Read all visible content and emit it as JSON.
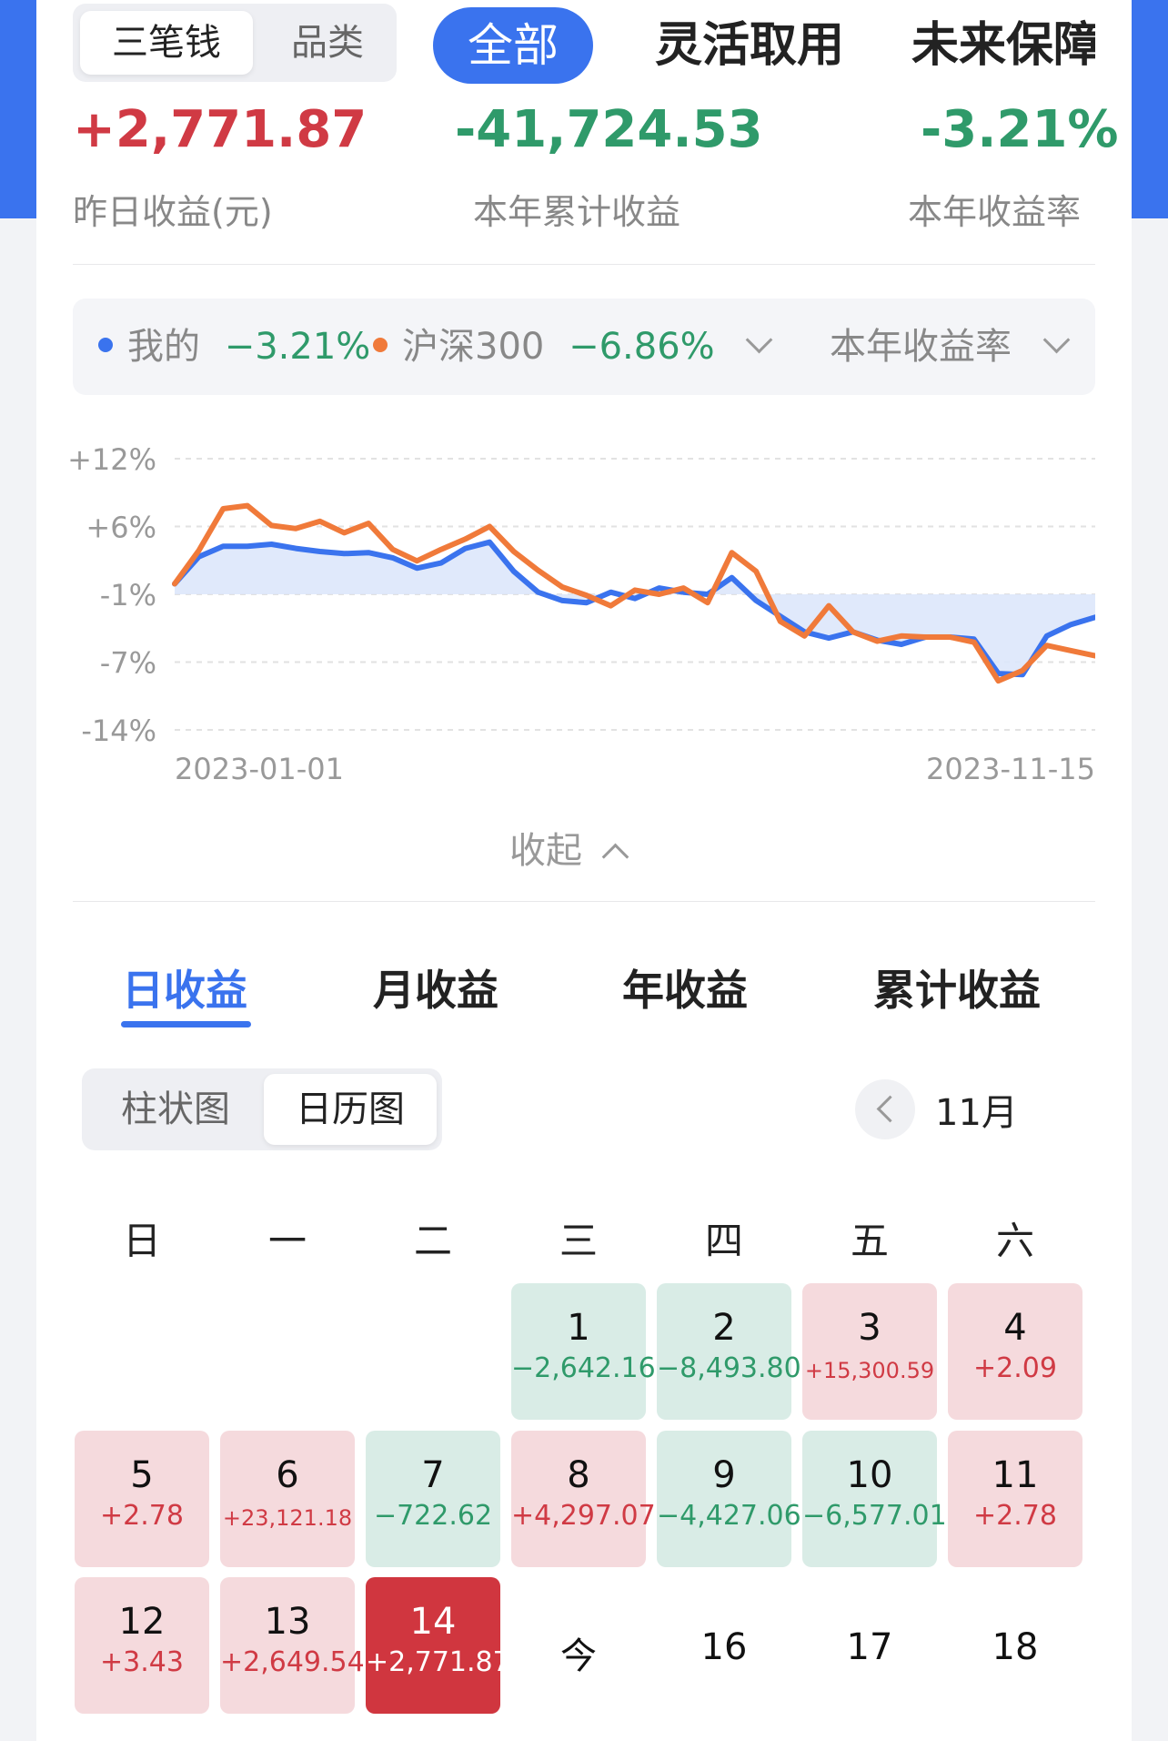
{
  "top": {
    "segments": [
      "三笔钱",
      "品类"
    ],
    "tabs": [
      "全部",
      "灵活取用",
      "未来保障"
    ]
  },
  "summary": [
    {
      "value": "+2,771.87",
      "label": "昨日收益(元)"
    },
    {
      "value": "-41,724.53",
      "label": "本年累计收益"
    },
    {
      "value": "-3.21%",
      "label": "本年收益率"
    }
  ],
  "legend": {
    "mine_label": "我的",
    "mine_value": "−3.21%",
    "index_label": "沪深300",
    "index_value": "−6.86%",
    "metric": "本年收益率"
  },
  "chart_data": {
    "type": "line",
    "x_range": [
      "2023-01-01",
      "2023-11-15"
    ],
    "xlabels": [
      "2023-01-01",
      "2023-11-15"
    ],
    "yticks": [
      "+12%",
      "+6%",
      "-1%",
      "-7%",
      "-14%"
    ],
    "ylim": [
      -14,
      12
    ],
    "colors": {
      "mine": "#3a73ee",
      "index": "#f07a3a"
    },
    "series": [
      {
        "name": "我的",
        "values": [
          0,
          2.6,
          3.6,
          3.6,
          3.8,
          3.4,
          3.1,
          2.9,
          3.0,
          2.5,
          1.5,
          2.0,
          3.4,
          4.0,
          1.2,
          -0.8,
          -1.6,
          -1.8,
          -0.8,
          -1.4,
          -0.4,
          -0.8,
          -1.0,
          0.6,
          -1.6,
          -3.1,
          -4.6,
          -5.2,
          -4.6,
          -5.4,
          -5.8,
          -5.1,
          -5.1,
          -5.3,
          -8.6,
          -8.7,
          -5.0,
          -3.9,
          -3.2
        ]
      },
      {
        "name": "沪深300",
        "values": [
          0,
          3.2,
          7.2,
          7.5,
          5.6,
          5.3,
          6.0,
          4.9,
          5.8,
          3.3,
          2.2,
          3.3,
          4.3,
          5.5,
          3.1,
          1.3,
          -0.3,
          -1.1,
          -2.1,
          -0.6,
          -1.0,
          -0.4,
          -1.8,
          3.0,
          1.2,
          -3.6,
          -5.0,
          -2.1,
          -4.6,
          -5.5,
          -5.0,
          -5.1,
          -5.1,
          -5.6,
          -9.3,
          -8.3,
          -5.9,
          -6.4,
          -6.9
        ]
      }
    ]
  },
  "collapse_label": "收起",
  "period_tabs": [
    "日收益",
    "月收益",
    "年收益",
    "累计收益"
  ],
  "chart_modes": [
    "柱状图",
    "日历图"
  ],
  "month": "11月",
  "weekdays": [
    "日",
    "一",
    "二",
    "三",
    "四",
    "五",
    "六"
  ],
  "calendar": [
    {
      "day": "1",
      "value": "−2,642.16",
      "sign": "neg",
      "col": 3,
      "row": 0
    },
    {
      "day": "2",
      "value": "−8,493.80",
      "sign": "neg",
      "col": 4,
      "row": 0
    },
    {
      "day": "3",
      "value": "+15,300.59",
      "sign": "pos",
      "col": 5,
      "row": 0,
      "small": true
    },
    {
      "day": "4",
      "value": "+2.09",
      "sign": "pos",
      "col": 6,
      "row": 0
    },
    {
      "day": "5",
      "value": "+2.78",
      "sign": "pos",
      "col": 0,
      "row": 1
    },
    {
      "day": "6",
      "value": "+23,121.18",
      "sign": "pos",
      "col": 1,
      "row": 1,
      "small": true
    },
    {
      "day": "7",
      "value": "−722.62",
      "sign": "neg",
      "col": 2,
      "row": 1
    },
    {
      "day": "8",
      "value": "+4,297.07",
      "sign": "pos",
      "col": 3,
      "row": 1
    },
    {
      "day": "9",
      "value": "−4,427.06",
      "sign": "neg",
      "col": 4,
      "row": 1
    },
    {
      "day": "10",
      "value": "−6,577.01",
      "sign": "neg",
      "col": 5,
      "row": 1
    },
    {
      "day": "11",
      "value": "+2.78",
      "sign": "pos",
      "col": 6,
      "row": 1
    },
    {
      "day": "12",
      "value": "+3.43",
      "sign": "pos",
      "col": 0,
      "row": 2
    },
    {
      "day": "13",
      "value": "+2,649.54",
      "sign": "pos",
      "col": 1,
      "row": 2
    },
    {
      "day": "14",
      "value": "+2,771.87",
      "sign": "today",
      "col": 2,
      "row": 2
    },
    {
      "day": "今",
      "value": "",
      "sign": "future",
      "col": 3,
      "row": 2
    },
    {
      "day": "16",
      "value": "",
      "sign": "future",
      "col": 4,
      "row": 2
    },
    {
      "day": "17",
      "value": "",
      "sign": "future",
      "col": 5,
      "row": 2
    },
    {
      "day": "18",
      "value": "",
      "sign": "future",
      "col": 6,
      "row": 2
    }
  ]
}
